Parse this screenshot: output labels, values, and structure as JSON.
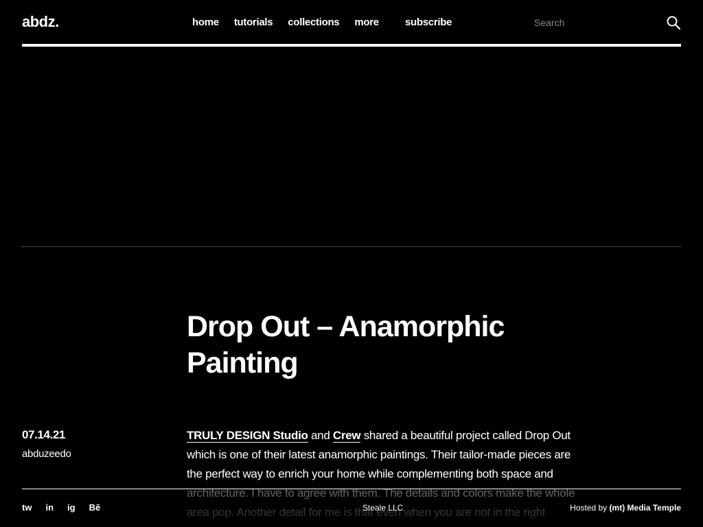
{
  "header": {
    "logo": "abdz.",
    "nav": [
      "home",
      "tutorials",
      "collections",
      "more"
    ],
    "subscribe": "subscribe",
    "search": {
      "placeholder": "Search",
      "value": ""
    }
  },
  "article": {
    "title": "Drop Out – Anamorphic Painting",
    "date": "07.14.21",
    "author": "abduzeedo",
    "link1": "TRULY DESIGN Studio",
    "text1": " and ",
    "link2": "Crew",
    "text2": " shared a beautiful project called Drop Out which is one of their latest anamorphic paintings. Their tailor-made pieces are the perfect way to enrich your home while complementing both space and architecture. I have to agree with them. The details and colors make the whole area pop. Another detail for me is that even when you are not in the right position, the painting looks quite pleasing and"
  },
  "footer": {
    "social": [
      "tw",
      "in",
      "ig",
      "Bē"
    ],
    "copyright": "Steale LLC",
    "hosted_prefix": "Hosted by ",
    "hosted_name": "(mt) Media Temple"
  }
}
